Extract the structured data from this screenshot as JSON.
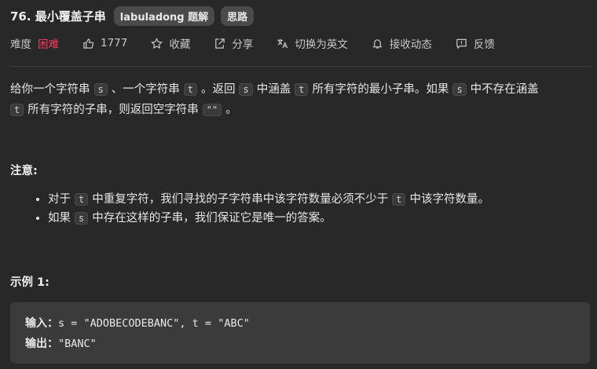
{
  "header": {
    "title": "76. 最小覆盖子串",
    "tag_solution": "labuladong 题解",
    "tag_hint": "思路"
  },
  "meta": {
    "difficulty_label": "难度",
    "difficulty_value": "困难",
    "likes": "1777",
    "favorite": "收藏",
    "share": "分享",
    "switch_lang": "切换为英文",
    "notify": "接收动态",
    "feedback": "反馈"
  },
  "description": {
    "p1_a": "给你一个字符串",
    "s": "s",
    "p1_b": "、一个字符串",
    "t": "t",
    "p1_c": "。返回",
    "p1_d": "中涵盖",
    "p1_e": "所有字符的最小子串。如果",
    "p1_f": "中不存在涵盖",
    "p1_g": "所有字符的子串，则返回空字符串",
    "empty": "\"\"",
    "p1_h": "。"
  },
  "note": {
    "title": "注意:",
    "item1_a": "对于",
    "item1_b": "中重复字符，我们寻找的子字符串中该字符数量必须不少于",
    "item1_c": "中该字符数量。",
    "item2_a": "如果",
    "item2_b": "中存在这样的子串，我们保证它是唯一的答案。"
  },
  "example": {
    "title": "示例 1:",
    "input_label": "输入：",
    "input_value": "s = \"ADOBECODEBANC\", t = \"ABC\"",
    "output_label": "输出：",
    "output_value": "\"BANC\""
  }
}
